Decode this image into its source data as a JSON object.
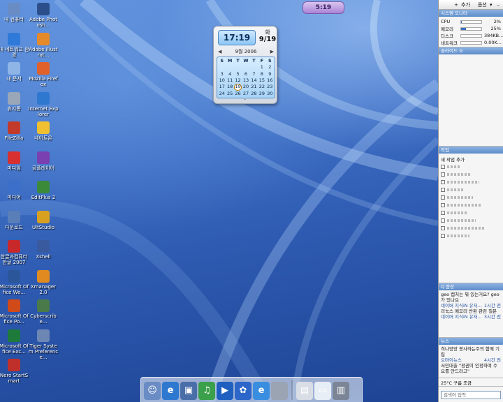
{
  "desktop_icons": [
    {
      "label": "내 컴퓨터",
      "icon": "computer-icon",
      "color": "#6a8cc4"
    },
    {
      "label": "Adobe Photosh...",
      "icon": "photoshop-icon",
      "color": "#2c4f8c"
    },
    {
      "label": "내 네트워크 환경",
      "icon": "network-globe-icon",
      "color": "#2f7ad8"
    },
    {
      "label": "Adobe Illustrat...",
      "icon": "illustrator-icon",
      "color": "#e58a2a"
    },
    {
      "label": "내 문서",
      "icon": "documents-folder-icon",
      "color": "#8fb4e6"
    },
    {
      "label": "Mozilla Firefox",
      "icon": "firefox-icon",
      "color": "#e0622a"
    },
    {
      "label": "휴지통",
      "icon": "recycle-bin-icon",
      "color": "#9aa7b8"
    },
    {
      "label": "Internet Explorer",
      "icon": "internet-explorer-icon",
      "color": "#2e78d0"
    },
    {
      "label": "FileZilla",
      "icon": "filezilla-icon",
      "color": "#c23a2a"
    },
    {
      "label": "네이트온",
      "icon": "nateon-icon",
      "color": "#f0c030"
    },
    {
      "label": "미디엄",
      "icon": "media-player-icon",
      "color": "#d83030"
    },
    {
      "label": "곰플레이어",
      "icon": "gom-player-icon",
      "color": "#7a3fb0"
    },
    {
      "label": "미디어",
      "icon": "play-arrow-icon",
      "color": "#3b6fc9"
    },
    {
      "label": "EditPlus 2",
      "icon": "editplus-icon",
      "color": "#3a8a3a"
    },
    {
      "label": "다운로드",
      "icon": "download-icon",
      "color": "#5a7fb8"
    },
    {
      "label": "UltStudio",
      "icon": "ultstudio-icon",
      "color": "#d8a020"
    },
    {
      "label": "한글과컴퓨터 한글 2007",
      "icon": "hangul-icon",
      "color": "#c8282a"
    },
    {
      "label": "Xshell",
      "icon": "xshell-icon",
      "color": "#3a5aa0"
    },
    {
      "label": "Microsoft Office Wo...",
      "icon": "word-icon",
      "color": "#2b579a"
    },
    {
      "label": "Xmanager 2.0",
      "icon": "xmanager-icon",
      "color": "#e08a20"
    },
    {
      "label": "Microsoft Office Po...",
      "icon": "powerpoint-icon",
      "color": "#d04a1a"
    },
    {
      "label": "Cyberscribe...",
      "icon": "cyberscribe-icon",
      "color": "#4a7a4a"
    },
    {
      "label": "Microsoft Office Exc...",
      "icon": "excel-icon",
      "color": "#1e7a3a"
    },
    {
      "label": "Tiger System Preference...",
      "icon": "system-preferences-icon",
      "color": "#6d87b5"
    },
    {
      "label": "Nero StartSmart",
      "icon": "nero-icon",
      "color": "#c0302a"
    }
  ],
  "mini_clock": {
    "time": "5:19"
  },
  "date_widget": {
    "time": "17:19",
    "day_name": "화",
    "day_date": "9/19",
    "month_title": "9월 2006",
    "weekdays": [
      "S",
      "M",
      "T",
      "W",
      "T",
      "F",
      "S"
    ],
    "today": "19",
    "weeks": [
      [
        "",
        "",
        "",
        "",
        "",
        "1",
        "2"
      ],
      [
        "3",
        "4",
        "5",
        "6",
        "7",
        "8",
        "9"
      ],
      [
        "10",
        "11",
        "12",
        "13",
        "14",
        "15",
        "16"
      ],
      [
        "17",
        "18",
        "19",
        "20",
        "21",
        "22",
        "23"
      ],
      [
        "24",
        "25",
        "26",
        "27",
        "28",
        "29",
        "30"
      ]
    ]
  },
  "dock": {
    "items": [
      {
        "icon": "finder-icon",
        "color": "#6a8cc4",
        "glyph": "☺"
      },
      {
        "icon": "internet-explorer-icon",
        "color": "#2e78d0",
        "glyph": "e"
      },
      {
        "icon": "picture-icon",
        "color": "#4a6ea8",
        "glyph": "▣"
      },
      {
        "icon": "music-note-icon",
        "color": "#3aa04a",
        "glyph": "♫"
      },
      {
        "icon": "quicktime-icon",
        "color": "#1e5fbf",
        "glyph": "▶"
      },
      {
        "icon": "photo-album-icon",
        "color": "#2c66c8",
        "glyph": "✿"
      },
      {
        "icon": "ie-blue-icon",
        "color": "#3a8ee0",
        "glyph": "e"
      },
      {
        "icon": "apple-icon",
        "color": "#9aa4b2",
        "glyph": ""
      }
    ],
    "right_items": [
      {
        "icon": "document-icon",
        "color": "#d8dde6",
        "glyph": "▤"
      },
      {
        "icon": "window-preview-icon",
        "color": "#e8eef6",
        "glyph": "▭"
      },
      {
        "icon": "trash-icon",
        "color": "#7b8595",
        "glyph": "▥"
      }
    ]
  },
  "sidebar": {
    "toolbar": {
      "add": "추가",
      "options": "옵션"
    },
    "system_monitor": {
      "title": "시스템 모니터",
      "rows": [
        {
          "label": "CPU",
          "value": "2%",
          "level": 0.02
        },
        {
          "label": "메모리",
          "value": "25%",
          "level": 0.25
        },
        {
          "label": "디스크",
          "value": "384KB...",
          "level": 0.0
        },
        {
          "label": "네트워크",
          "value": "0.00K...",
          "level": 0.0
        }
      ]
    },
    "slideshow": {
      "title": "슬라이드 쇼"
    },
    "todo": {
      "title": "작업",
      "add_label": "새 작업 추가",
      "count": 10
    },
    "qa": {
      "title": "Q 묻장",
      "lines": [
        "geo 캡처는 뭐 있는거요? geo가 있나요",
        "네이버 지식iN 유저...",
        "리눅스 메모리 반환 관련 질문",
        "네이버 지식iN 유저..."
      ],
      "times": [
        "1시간 전",
        "3시간 전"
      ]
    },
    "news": {
      "title": "뉴스",
      "lines": [
        "히나앙앙 봉사하는주의 함께 기립",
        "오마이뉴스",
        "서민대출 \"정권이 인정하며 수요를 만드라고\""
      ],
      "time": "4시간 전"
    },
    "weather": {
      "text": "25°C 구름 조금"
    },
    "search_placeholder": "검색어 입력"
  }
}
